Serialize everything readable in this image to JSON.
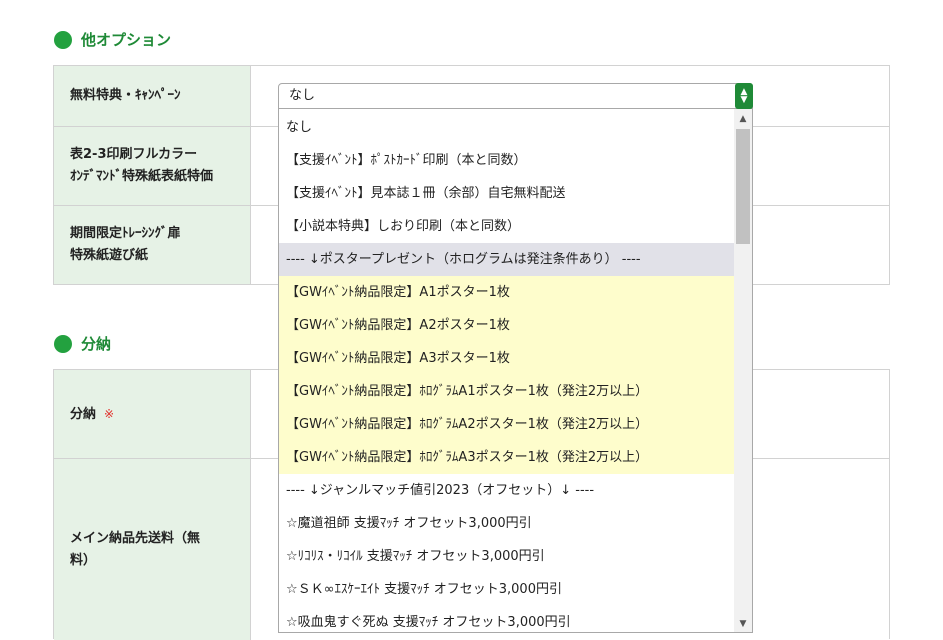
{
  "sections": {
    "other_options": {
      "title": "他オプション"
    },
    "split": {
      "title": "分納"
    }
  },
  "other_options_rows": {
    "row1": {
      "label": "無料特典・ｷｬﾝﾍﾟｰﾝ"
    },
    "row2": {
      "label_line1": "表2-3印刷フルカラー",
      "label_line2": "ｵﾝﾃﾞﾏﾝﾄﾞ特殊紙表紙特価"
    },
    "row3": {
      "label_line1": "期間限定ﾄﾚｰｼﾝｸﾞ扉",
      "label_line2": "特殊紙遊び紙"
    }
  },
  "split_rows": {
    "row1": {
      "label": "分納",
      "required_mark": "※"
    },
    "row2": {
      "label_line1": "メイン納品先送料（無",
      "label_line2": "料）"
    }
  },
  "select": {
    "value": "なし",
    "arrow_icon": "up-down-chevron-icon",
    "options": [
      "なし",
      "【支援ｲﾍﾞﾝﾄ】ﾎﾟｽﾄｶｰﾄﾞ印刷（本と同数）",
      "【支援ｲﾍﾞﾝﾄ】見本誌１冊（余部）自宅無料配送",
      "【小説本特典】しおり印刷（本と同数）",
      "---- ↓ポスタープレゼント（ホログラムは発注条件あり） ----",
      "【GWｲﾍﾞﾝﾄ納品限定】A1ポスター1枚",
      "【GWｲﾍﾞﾝﾄ納品限定】A2ポスター1枚",
      "【GWｲﾍﾞﾝﾄ納品限定】A3ポスター1枚",
      "【GWｲﾍﾞﾝﾄ納品限定】ﾎﾛｸﾞﾗﾑA1ポスター1枚（発注2万以上）",
      "【GWｲﾍﾞﾝﾄ納品限定】ﾎﾛｸﾞﾗﾑA2ポスター1枚（発注2万以上）",
      "【GWｲﾍﾞﾝﾄ納品限定】ﾎﾛｸﾞﾗﾑA3ポスター1枚（発注2万以上）",
      "---- ↓ジャンルマッチ値引2023（オフセット）↓ ----",
      "☆魔道祖師 支援ﾏｯﾁ オフセット3,000円引",
      "☆ﾘｺﾘｽ・ﾘｺｲﾙ 支援ﾏｯﾁ オフセット3,000円引",
      "☆ＳＫ∞ｴｽｹｰｴｲﾄ 支援ﾏｯﾁ オフセット3,000円引",
      "☆吸血鬼すぐ死ぬ 支援ﾏｯﾁ オフセット3,000円引"
    ]
  },
  "colors": {
    "accent_green": "#1f8a37",
    "label_bg": "#e6f2e6",
    "highlight_yellow": "#fefdcc",
    "selected_gray": "#e1e1e8",
    "required_red": "#e0312c"
  }
}
